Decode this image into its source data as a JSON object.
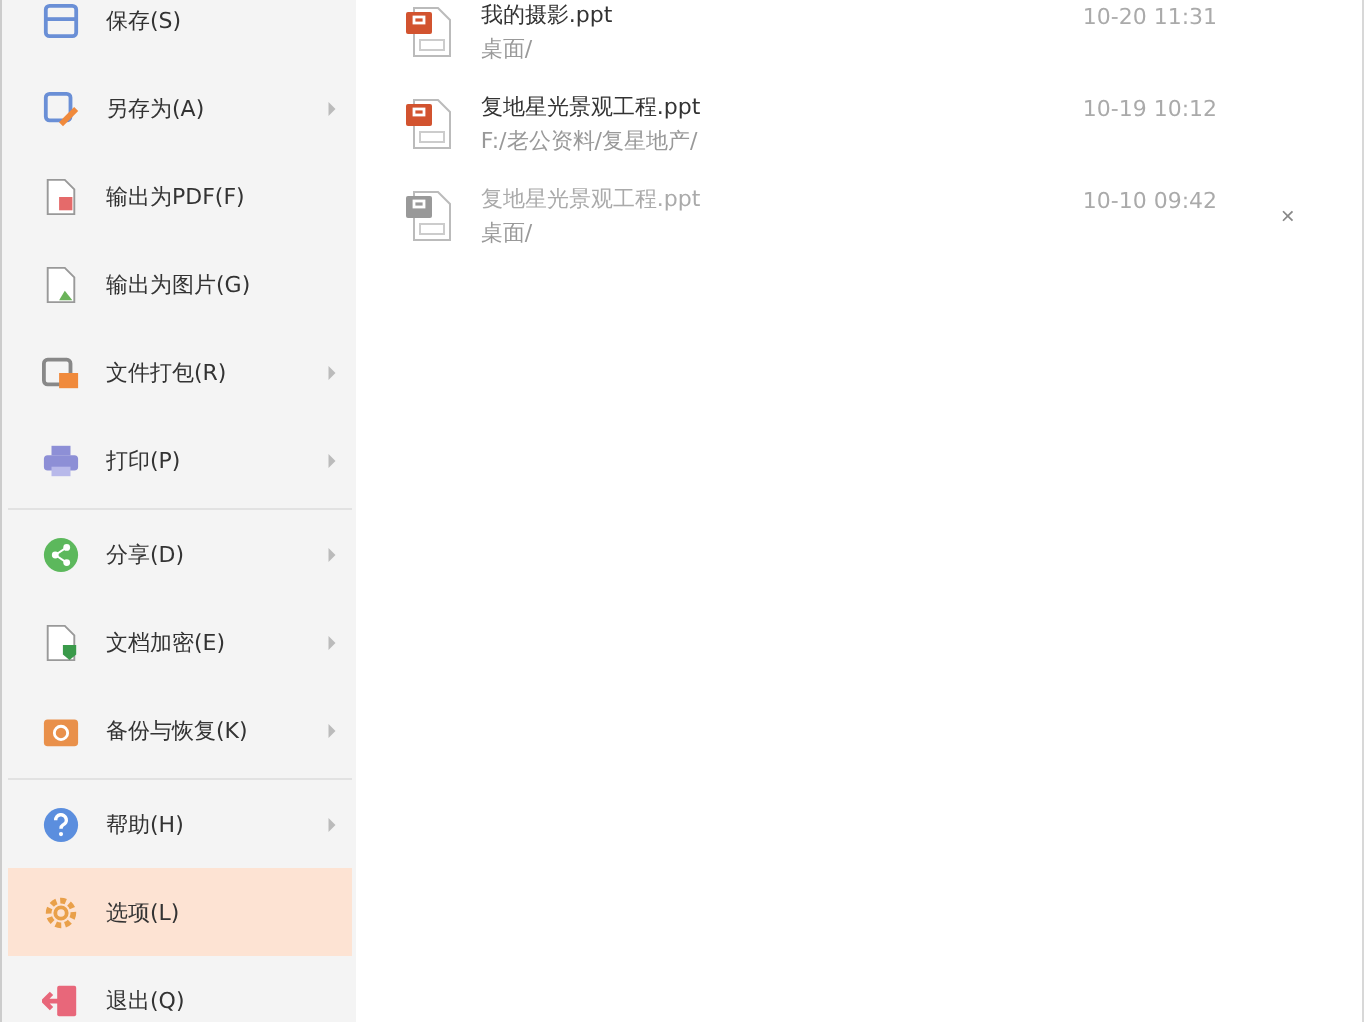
{
  "menu": {
    "items": [
      {
        "kind": "save",
        "label": "保存(S)",
        "submenu": false,
        "selected": false
      },
      {
        "kind": "save-as",
        "label": "另存为(A)",
        "submenu": true,
        "selected": false
      },
      {
        "kind": "pdf",
        "label": "输出为PDF(F)",
        "submenu": false,
        "selected": false
      },
      {
        "kind": "image",
        "label": "输出为图片(G)",
        "submenu": false,
        "selected": false
      },
      {
        "kind": "pack",
        "label": "文件打包(R)",
        "submenu": true,
        "selected": false
      },
      {
        "kind": "print",
        "label": "打印(P)",
        "submenu": true,
        "selected": false,
        "divider_after": true
      },
      {
        "kind": "share",
        "label": "分享(D)",
        "submenu": true,
        "selected": false
      },
      {
        "kind": "encrypt",
        "label": "文档加密(E)",
        "submenu": true,
        "selected": false
      },
      {
        "kind": "backup",
        "label": "备份与恢复(K)",
        "submenu": true,
        "selected": false,
        "divider_after": true
      },
      {
        "kind": "help",
        "label": "帮助(H)",
        "submenu": true,
        "selected": false
      },
      {
        "kind": "options",
        "label": "选项(L)",
        "submenu": false,
        "selected": true
      },
      {
        "kind": "exit",
        "label": "退出(Q)",
        "submenu": false,
        "selected": false
      }
    ]
  },
  "recent_files": [
    {
      "name": "我的摄影.ppt",
      "path": "桌面/",
      "time": "10-20 11:31",
      "disabled": false
    },
    {
      "name": "复地星光景观工程.ppt",
      "path": "F:/老公资料/复星地产/",
      "time": "10-19 10:12",
      "disabled": false
    },
    {
      "name": "复地星光景观工程.ppt",
      "path": "桌面/",
      "time": "10-10 09:42",
      "disabled": true
    }
  ],
  "close_symbol": "×"
}
